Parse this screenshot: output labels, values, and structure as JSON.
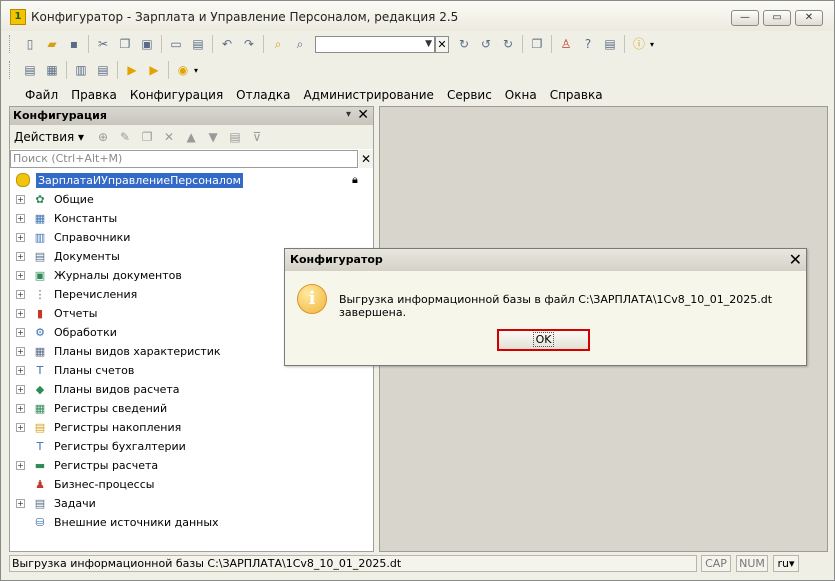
{
  "window": {
    "title": "Конфигуратор - Зарплата и Управление Персоналом, редакция 2.5",
    "app_icon": "1c-icon",
    "controls": {
      "minimize": "—",
      "maximize": "▭",
      "close": "✕"
    }
  },
  "menu": [
    "Файл",
    "Правка",
    "Конфигурация",
    "Отладка",
    "Администрирование",
    "Сервис",
    "Окна",
    "Справка"
  ],
  "config_panel": {
    "title": "Конфигурация",
    "actions_label": "Действия",
    "search_placeholder": "Поиск (Ctrl+Alt+M)",
    "root": "ЗарплатаИУправлениеПерсоналом",
    "items": [
      {
        "label": "Общие",
        "icon": "common-icon",
        "glyph": "✿",
        "color": "#2e8b57",
        "expandable": true
      },
      {
        "label": "Константы",
        "icon": "constants-icon",
        "glyph": "▦",
        "color": "#3a6fb0",
        "expandable": true
      },
      {
        "label": "Справочники",
        "icon": "catalogs-icon",
        "glyph": "▥",
        "color": "#3a6fb0",
        "expandable": true
      },
      {
        "label": "Документы",
        "icon": "documents-icon",
        "glyph": "▤",
        "color": "#5a6d86",
        "expandable": true
      },
      {
        "label": "Журналы документов",
        "icon": "journals-icon",
        "glyph": "▣",
        "color": "#2e8b57",
        "expandable": true
      },
      {
        "label": "Перечисления",
        "icon": "enums-icon",
        "glyph": "⋮",
        "color": "#555555",
        "expandable": true
      },
      {
        "label": "Отчеты",
        "icon": "reports-icon",
        "glyph": "▮",
        "color": "#c0392b",
        "expandable": true
      },
      {
        "label": "Обработки",
        "icon": "processors-icon",
        "glyph": "⚙",
        "color": "#3a6fb0",
        "expandable": true
      },
      {
        "label": "Планы видов характеристик",
        "icon": "chart-of-characteristics-icon",
        "glyph": "▦",
        "color": "#5a6d86",
        "expandable": true
      },
      {
        "label": "Планы счетов",
        "icon": "chart-of-accounts-icon",
        "glyph": "Т",
        "color": "#3a6fb0",
        "expandable": true
      },
      {
        "label": "Планы видов расчета",
        "icon": "calculation-types-icon",
        "glyph": "◆",
        "color": "#2e8b57",
        "expandable": true
      },
      {
        "label": "Регистры сведений",
        "icon": "info-registers-icon",
        "glyph": "▦",
        "color": "#2e8b57",
        "expandable": true
      },
      {
        "label": "Регистры накопления",
        "icon": "accumulation-registers-icon",
        "glyph": "▤",
        "color": "#d4a017",
        "expandable": true
      },
      {
        "label": "Регистры бухгалтерии",
        "icon": "accounting-registers-icon",
        "glyph": "Т",
        "color": "#3a6fb0",
        "expandable": false
      },
      {
        "label": "Регистры расчета",
        "icon": "calculation-registers-icon",
        "glyph": "▬",
        "color": "#2e8b57",
        "expandable": true
      },
      {
        "label": "Бизнес-процессы",
        "icon": "business-processes-icon",
        "glyph": "♟",
        "color": "#c0392b",
        "expandable": false
      },
      {
        "label": "Задачи",
        "icon": "tasks-icon",
        "glyph": "▤",
        "color": "#5a6d86",
        "expandable": true
      },
      {
        "label": "Внешние источники данных",
        "icon": "external-data-sources-icon",
        "glyph": "⛁",
        "color": "#3a6fb0",
        "expandable": false
      }
    ]
  },
  "dialog": {
    "title": "Конфигуратор",
    "message": "Выгрузка информационной базы в файл C:\\ЗАРПЛАТА\\1Cv8_10_01_2025.dt завершена.",
    "ok_label": "OK",
    "icon": "info-icon"
  },
  "statusbar": {
    "text": "Выгрузка информационной базы C:\\ЗАРПЛАТА\\1Cv8_10_01_2025.dt",
    "cap": "CAP",
    "num": "NUM",
    "lang": "ru"
  },
  "colors": {
    "selection": "#3369c7",
    "ok_highlight": "#d40000"
  }
}
